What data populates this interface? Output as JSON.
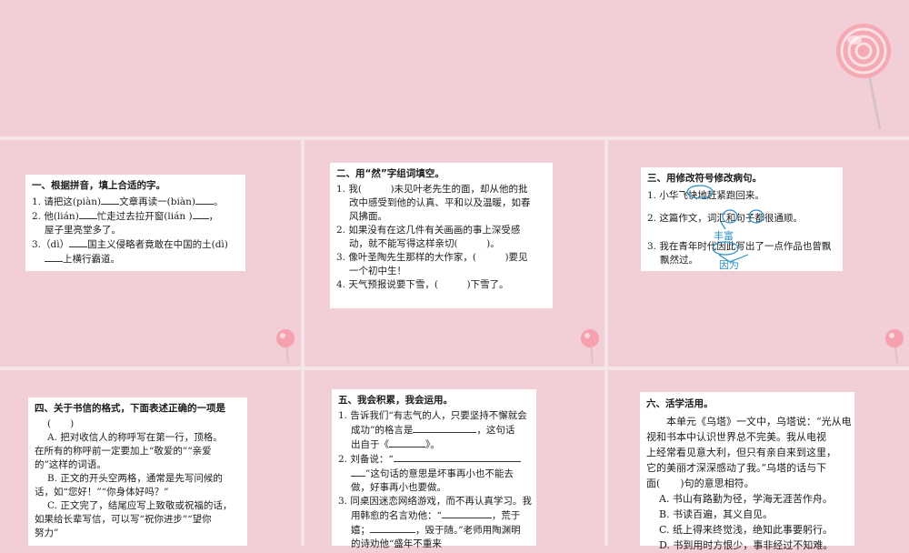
{
  "colors": {
    "bg": "#f2cfd6",
    "slide": "#f9dde2",
    "card": "#ffffff",
    "mark": "#2a8fc7"
  },
  "s1": {
    "title": "一、根据拼音，填上合适的字。",
    "l1a": "1. 请把这(piàn)",
    "l1b": "文章再读一(biàn)",
    "l1c": "。",
    "l2a": "2. 他(lián)",
    "l2b": "忙走过去拉开窗(lián )",
    "l2c": "，",
    "l2d": "屋子里亮堂多了。",
    "l3a": "3.（dì）",
    "l3b": "国主义侵略者竟敢在中国的土(dì)",
    "l3c": "上横行霸道。"
  },
  "s2": {
    "title": "二、用“然”字组词填空。",
    "l1": "1. 我(　　　)未见叶老先生的面，却从他的批",
    "l1b": "改中感受到他的认真、平和以及温暖，如春",
    "l1c": "风拂面。",
    "l2": "2. 如果没有在这几件有关画画的事上深受感",
    "l2b": "动，就不能写得这样亲切(　　　)。",
    "l3": "3. 像叶圣陶先生那样的大作家，(　　　)要见",
    "l3b": "一个初中生！",
    "l4": "4. 天气预报说要下雪，(　　　)下雪了。"
  },
  "s3": {
    "title": "三、用修改符号修改病句。",
    "l1": "1. 小华飞快地赶紧跑回来。",
    "l2": "2. 这篇作文，词汇和句子都很通顺。",
    "fix2": "丰富",
    "l3": "3. 我在青年时代因此写出了一点作品也曾飘",
    "l3b": "飘然过。",
    "fix3": "因为"
  },
  "s4": {
    "title": "四、关于书信的格式，下面表述正确的一项是",
    "paren": "(　　)",
    "a1": "A. 把对收信人的称呼写在第一行，顶格。",
    "a2": "在所有的称呼前一定要加上“敬爱的”“亲爱",
    "a3": "的”这样的词语。",
    "b1": "B. 正文的开头空两格，通常是先写问候的",
    "b2": "话，如“您好！”“你身体好吗？”",
    "c1": "C. 正文完了，结尾应写上致敬或祝福的话，",
    "c2": "如果给长辈写信，可以写“祝你进步”“望你",
    "c3": "努力”"
  },
  "s5": {
    "title": "五、我会积累，我会运用。",
    "l1": "1. 告诉我们“有志气的人，只要坚持不懈就会",
    "l1b": "成功”的格言是",
    "l1c": "，这句话",
    "l1d": "出自于《",
    "l1e": "》。",
    "l2": "2. 刘备说：“",
    "l2b": "”这句话的意思是坏事再小也不能去",
    "l2c": "做，好事再小也要做。",
    "l3": "3. 同桌因迷恋网络游戏，而不再认真学习。我",
    "l3b": "用韩愈的名言劝他：“",
    "l3c": "，荒于",
    "l3d": "嬉；",
    "l3e": "，毁于随。”老师用陶渊明",
    "l3f": "的诗劝他“盛年不重来"
  },
  "s6": {
    "title": "六、活学活用。",
    "p1": "本单元《乌塔》一文中，乌塔说：“光从电",
    "p2": "视和书本中认识世界总不完美。我从电视",
    "p3": "上经常看见意大利，但只有亲自来到这里，",
    "p4": "它的美丽才深深感动了我。”乌塔的话与下",
    "p5": "面(　　)句的意思相符。",
    "a": "A. 书山有路勤为径，学海无涯苦作舟。",
    "b": "B. 书读百遍，其义自见。",
    "c": "C. 纸上得来终觉浅，绝知此事要躬行。",
    "d": "D. 书到用时方恨少，事非经过不知难。"
  }
}
